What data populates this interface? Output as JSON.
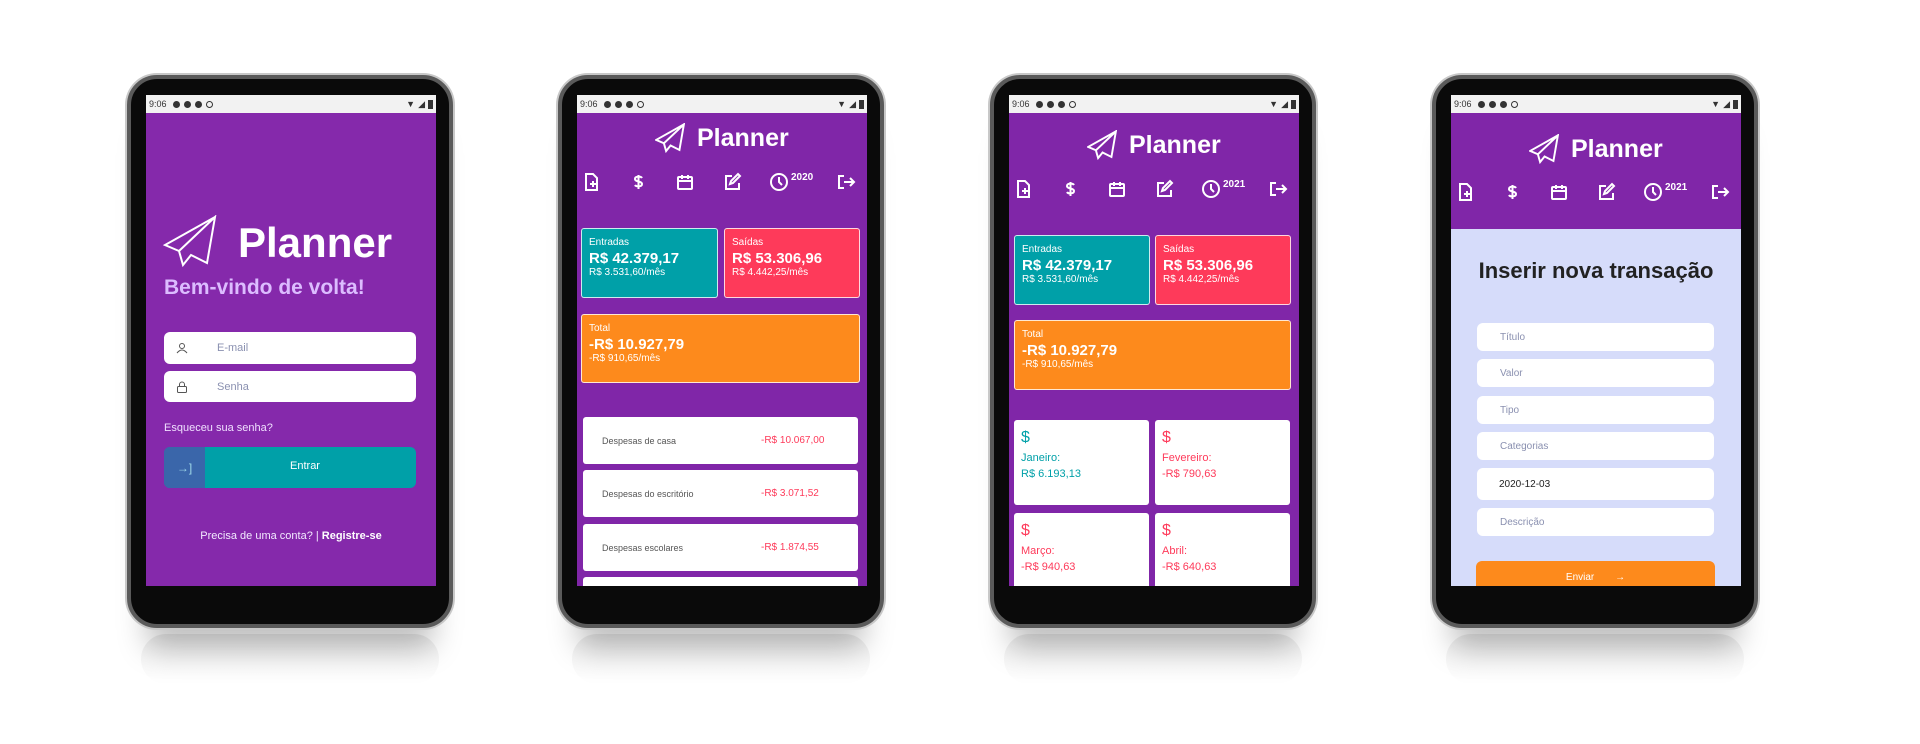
{
  "status_bar": {
    "time": "9:06"
  },
  "app": {
    "name": "Planner"
  },
  "login": {
    "welcome": "Bem-vindo de volta!",
    "email_placeholder": "E-mail",
    "password_placeholder": "Senha",
    "forgot": "Esqueceu sua senha?",
    "submit": "Entrar",
    "need_account": "Precisa de uma conta? |",
    "register": "Registre-se"
  },
  "dashboard_2020": {
    "year": "2020",
    "income": {
      "label": "Entradas",
      "value": "R$ 42.379,17",
      "monthly": "R$ 3.531,60/mês"
    },
    "expenses": {
      "label": "Saídas",
      "value": "R$ 53.306,96",
      "monthly": "R$ 4.442,25/mês"
    },
    "total": {
      "label": "Total",
      "value": "-R$ 10.927,79",
      "monthly": "-R$ 910,65/mês"
    },
    "categories": [
      {
        "name": "Despesas de casa",
        "amount": "-R$ 10.067,00"
      },
      {
        "name": "Despesas do escritório",
        "amount": "-R$ 3.071,52"
      },
      {
        "name": "Despesas escolares",
        "amount": "-R$ 1.874,55"
      }
    ]
  },
  "dashboard_2021": {
    "year": "2021",
    "income": {
      "label": "Entradas",
      "value": "R$ 42.379,17",
      "monthly": "R$ 3.531,60/mês"
    },
    "expenses": {
      "label": "Saídas",
      "value": "R$ 53.306,96",
      "monthly": "R$ 4.442,25/mês"
    },
    "total": {
      "label": "Total",
      "value": "-R$ 10.927,79",
      "monthly": "-R$ 910,65/mês"
    },
    "months": [
      {
        "icon": "$",
        "name": "Janeiro:",
        "value": "R$ 6.193,13"
      },
      {
        "icon": "$",
        "name": "Fevereiro:",
        "value": "-R$ 790,63"
      },
      {
        "icon": "$",
        "name": "Março:",
        "value": "-R$ 940,63"
      },
      {
        "icon": "$",
        "name": "Abril:",
        "value": "-R$ 640,63"
      }
    ]
  },
  "form": {
    "year": "2021",
    "title": "Inserir nova transação",
    "fields": {
      "title": "Título",
      "value": "Valor",
      "type": "Tipo",
      "categories": "Categorias",
      "date": "2020-12-03",
      "description": "Descrição"
    },
    "submit": "Enviar"
  },
  "colors": {
    "purple": "#8026a8",
    "teal": "#00a0a8",
    "red": "#fe3a5a",
    "orange": "#fd8a1c",
    "form_bg": "#d6dcfa"
  }
}
